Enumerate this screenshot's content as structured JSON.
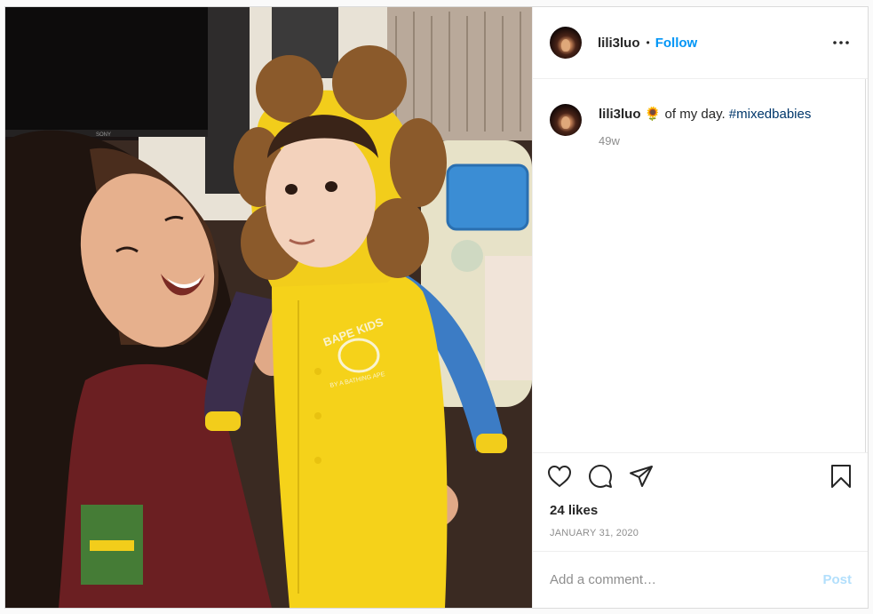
{
  "post": {
    "image_alt": "Smiling woman holding a baby wearing a yellow bear-ear hoodie onesie",
    "onesie_print": "BAPE KIDS",
    "onesie_print_sub": "BY A BATHING APE",
    "tv_brand": "SONY"
  },
  "header": {
    "username": "lili3luo",
    "separator": "•",
    "follow_label": "Follow",
    "more_icon": "more-horizontal-icon"
  },
  "caption": {
    "username": "lili3luo",
    "emoji": "🌻",
    "text": " of my day. ",
    "hashtag": "#mixedbabies",
    "time": "49w"
  },
  "actions": {
    "like_icon": "heart-icon",
    "comment_icon": "comment-icon",
    "share_icon": "send-icon",
    "save_icon": "bookmark-icon"
  },
  "likes": "24 likes",
  "date": "JANUARY 31, 2020",
  "comment_box": {
    "placeholder": "Add a comment…",
    "post_label": "Post"
  },
  "colors": {
    "link_blue": "#0095f6",
    "hashtag_blue": "#00376b",
    "post_disabled": "#b2dffc",
    "border": "#dbdbdb"
  }
}
